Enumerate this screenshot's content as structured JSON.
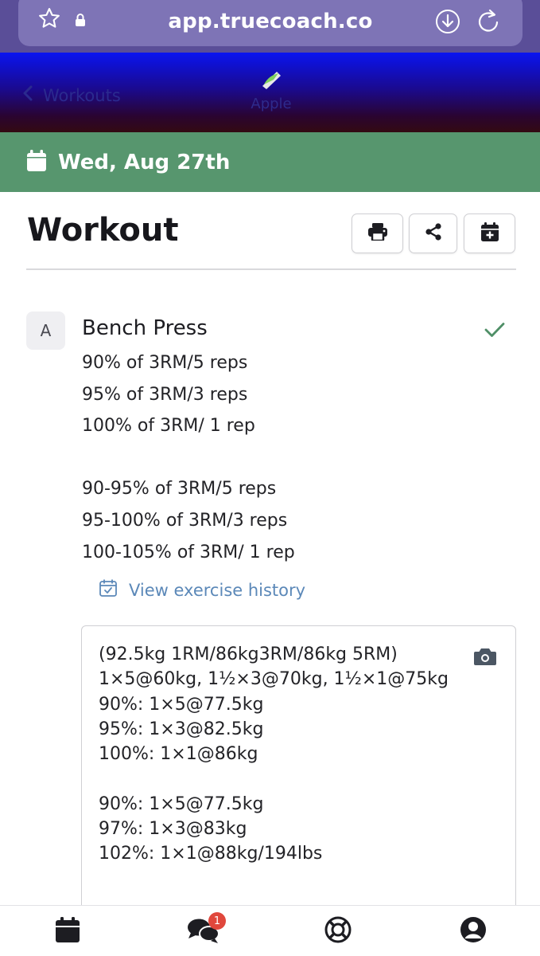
{
  "browser": {
    "url": "app.truecoach.co"
  },
  "header": {
    "back_label": "Workouts",
    "logo_text": "Apple"
  },
  "date_bar": {
    "date": "Wed, Aug 27th"
  },
  "workout": {
    "title": "Workout"
  },
  "exercise": {
    "letter": "A",
    "name": "Bench Press",
    "lines": [
      "90% of 3RM/5 reps",
      "95% of 3RM/3 reps",
      "100% of 3RM/ 1 rep",
      "",
      "90-95% of 3RM/5 reps",
      "95-100% of 3RM/3 reps",
      "100-105% of 3RM/ 1 rep"
    ],
    "history_label": "View exercise history"
  },
  "notes": {
    "lines": [
      "(92.5kg 1RM/86kg3RM/86kg 5RM)",
      "1×5@60kg, 1½×3@70kg, 1½×1@75kg",
      "90%: 1×5@77.5kg",
      "95%: 1×3@82.5kg",
      "100%: 1×1@86kg",
      "",
      "90%: 1×5@77.5kg",
      "97%: 1×3@83kg",
      "102%: 1×1@88kg/194lbs"
    ]
  },
  "bottom_nav": {
    "messages_badge": "1"
  },
  "colors": {
    "browser_bar": "#5a4e98",
    "date_bar": "#57966e",
    "link": "#5b88b8",
    "check": "#4f8f67",
    "badge": "#e0473c"
  }
}
